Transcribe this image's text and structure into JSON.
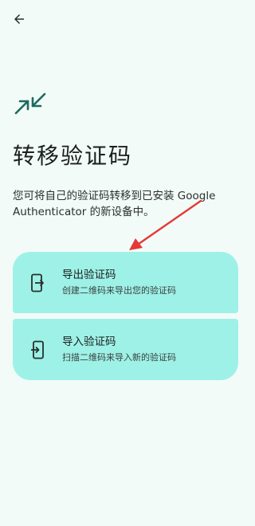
{
  "header": {
    "back_icon": "arrow-back-icon"
  },
  "hero": {
    "icon": "compress-arrows-icon",
    "icon_color": "#1d6b5e"
  },
  "title": "转移验证码",
  "description": "您可将自己的验证码转移到已安装 Google Authenticator 的新设备中。",
  "options": [
    {
      "title": "导出验证码",
      "subtitle": "创建二维码来导出您的验证码",
      "icon": "phone-export-icon"
    },
    {
      "title": "导入验证码",
      "subtitle": "扫描二维码来导入新的验证码",
      "icon": "phone-import-icon"
    }
  ],
  "colors": {
    "background": "#f2fbf8",
    "option_bg": "#9ef1e7",
    "annotation_red": "#e53935"
  }
}
